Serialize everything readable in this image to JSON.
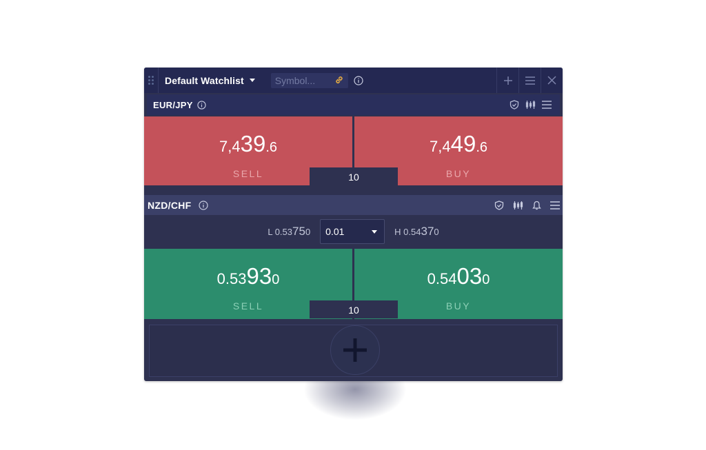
{
  "window": {
    "title": "Default Watchlist",
    "symbol_placeholder": "Symbol..."
  },
  "instruments": [
    {
      "pair": "EUR/JPY",
      "sell": {
        "prefix": "7,4",
        "big": "39",
        "pip": ".6",
        "label": "SELL"
      },
      "buy": {
        "prefix": "7,4",
        "big": "49",
        "pip": ".6",
        "label": "BUY"
      },
      "quantity": "10"
    },
    {
      "pair": "NZD/CHF",
      "low": {
        "prefix": "L 0.53",
        "big": "75",
        "pip": "0"
      },
      "high": {
        "prefix": "H 0.54",
        "big": "37",
        "pip": "0"
      },
      "lot_size": "0.01",
      "sell": {
        "prefix": "0.53",
        "big": "93",
        "pip": "0",
        "label": "SELL"
      },
      "buy": {
        "prefix": "0.54",
        "big": "03",
        "pip": "0",
        "label": "BUY"
      },
      "quantity": "10"
    }
  ],
  "colors": {
    "sell_red": "#c4525a",
    "buy_green": "#2c8d6d",
    "panel": "#2e3150",
    "titlebar": "#242852",
    "link_icon": "#e0a844"
  },
  "icons": {
    "titlebar": [
      "drag-handle-icon",
      "caret-down-icon",
      "link-icon",
      "info-icon",
      "plus-icon",
      "menu-icon",
      "close-icon"
    ],
    "instrument": [
      "info-icon",
      "shield-icon",
      "chart-candles-icon",
      "bell-icon",
      "menu-icon"
    ],
    "add": "plus-icon"
  }
}
